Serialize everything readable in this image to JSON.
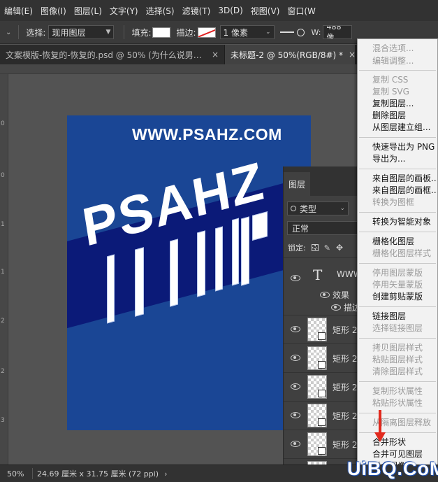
{
  "menubar": {
    "items": [
      "编辑(E)",
      "图像(I)",
      "图层(L)",
      "文字(Y)",
      "选择(S)",
      "滤镜(T)",
      "3D(D)",
      "视图(V)",
      "窗口(W"
    ]
  },
  "options": {
    "select_label": "选择:",
    "select_value": "现用图层",
    "fill_label": "填充:",
    "stroke_label": "描边:",
    "stroke_width": "1 像素",
    "width_label": "W:",
    "width_value": "488 像"
  },
  "tabs": [
    {
      "label": "文案模版-恢复的-恢复的.psd @ 50% (为什么说男人...",
      "active": false
    },
    {
      "label": "未标题-2 @ 50%(RGB/8#) *",
      "active": true
    }
  ],
  "ruler_left_labels": [
    "0",
    "0",
    "1",
    "1",
    "2",
    "2",
    "3"
  ],
  "canvas": {
    "url_text": "WWW.PSAHZ.COM",
    "logo_text": "PSAHZ",
    "background_color": "#1a4695",
    "band_color": "#0b1a78"
  },
  "layers_panel": {
    "tab_label": "图层",
    "filter_value": "类型",
    "blend_mode": "正常",
    "lock_label": "锁定:",
    "text_layer_name": "WWW",
    "effects_label": "效果",
    "stroke_effect_label": "描边",
    "shape_layers": [
      "矩形 2",
      "矩形 2",
      "矩形 2",
      "矩形 2",
      "矩形 2",
      "矩形 2",
      "矩形"
    ]
  },
  "context_menu": {
    "items": [
      {
        "label": "混合选项...",
        "enabled": false
      },
      {
        "label": "编辑调整...",
        "enabled": false
      },
      {
        "label": "复制 CSS",
        "enabled": false
      },
      {
        "label": "复制 SVG",
        "enabled": false
      },
      {
        "label": "复制图层...",
        "enabled": true
      },
      {
        "label": "删除图层",
        "enabled": true
      },
      {
        "label": "从图层建立组...",
        "enabled": true
      },
      {
        "label": "快速导出为 PNG",
        "enabled": true
      },
      {
        "label": "导出为...",
        "enabled": true
      },
      {
        "label": "来自图层的画板...",
        "enabled": true
      },
      {
        "label": "来自图层的画框...",
        "enabled": true
      },
      {
        "label": "转换为图框",
        "enabled": false
      },
      {
        "label": "转换为智能对象",
        "enabled": true
      },
      {
        "label": "栅格化图层",
        "enabled": true
      },
      {
        "label": "栅格化图层样式",
        "enabled": false
      },
      {
        "label": "停用图层蒙版",
        "enabled": false
      },
      {
        "label": "停用矢量蒙版",
        "enabled": false
      },
      {
        "label": "创建剪贴蒙版",
        "enabled": true
      },
      {
        "label": "链接图层",
        "enabled": true
      },
      {
        "label": "选择链接图层",
        "enabled": false
      },
      {
        "label": "拷贝图层样式",
        "enabled": false
      },
      {
        "label": "粘贴图层样式",
        "enabled": false
      },
      {
        "label": "清除图层样式",
        "enabled": false
      },
      {
        "label": "复制形状属性",
        "enabled": false
      },
      {
        "label": "粘贴形状属性",
        "enabled": false
      },
      {
        "label": "从隔离图层释放",
        "enabled": false
      },
      {
        "label": "合并形状",
        "enabled": true
      },
      {
        "label": "合并可见图层",
        "enabled": true
      },
      {
        "label": "拼合图像",
        "enabled": true
      }
    ]
  },
  "status": {
    "zoom": "50%",
    "doc_size": "24.69 厘米 x 31.75 厘米 (72 ppi)"
  },
  "watermark": "UiBQ.CoM",
  "colors": {
    "accent_arrow": "#e12a1e"
  }
}
